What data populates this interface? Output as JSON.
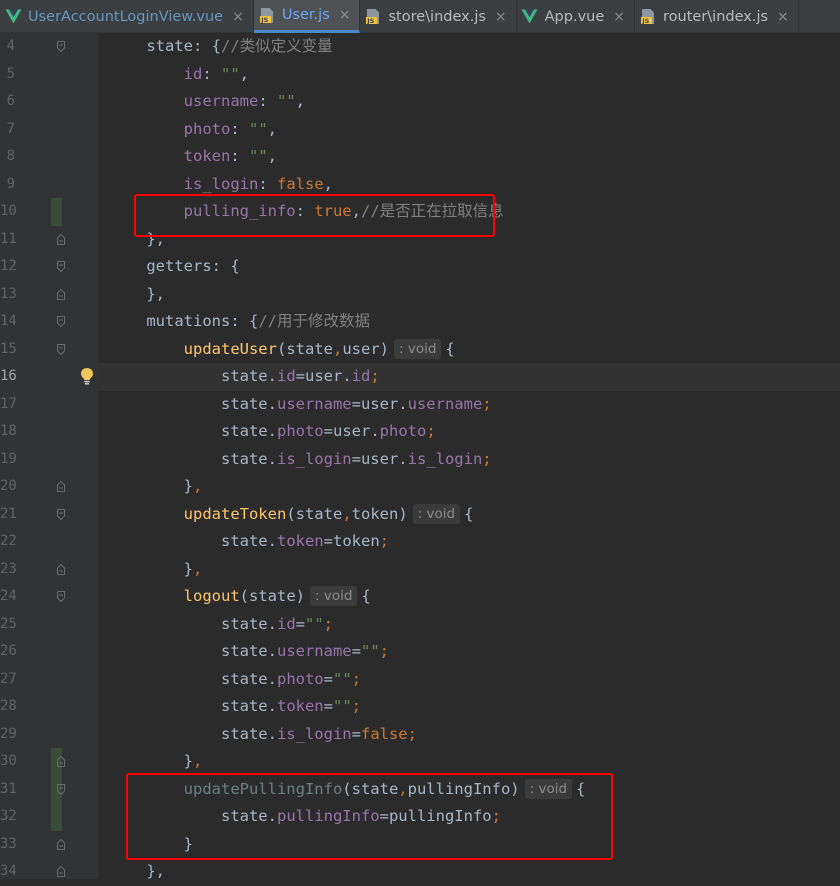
{
  "tabs": [
    {
      "label": "UserAccountLoginView.vue",
      "icon": "vue-icon",
      "active": false
    },
    {
      "label": "User.js",
      "icon": "js-file-icon",
      "active": true
    },
    {
      "label": "store\\index.js",
      "icon": "js-file-icon",
      "active": false
    },
    {
      "label": "App.vue",
      "icon": "vue-icon",
      "active": false
    },
    {
      "label": "router\\index.js",
      "icon": "js-file-icon",
      "active": false
    }
  ],
  "close_glyph": "×",
  "current_line": "16",
  "lines": [
    {
      "n": "4",
      "t": [
        [
          "plain",
          "    state: {"
        ],
        [
          "cmt",
          "//类似定义变量"
        ]
      ]
    },
    {
      "n": "5",
      "t": [
        [
          "plain",
          "        "
        ],
        [
          "prop",
          "id"
        ],
        [
          "plain",
          ": "
        ],
        [
          "str",
          "\"\""
        ],
        [
          "plain",
          ","
        ]
      ]
    },
    {
      "n": "6",
      "t": [
        [
          "plain",
          "        "
        ],
        [
          "prop",
          "username"
        ],
        [
          "plain",
          ": "
        ],
        [
          "str",
          "\"\""
        ],
        [
          "plain",
          ","
        ]
      ]
    },
    {
      "n": "7",
      "t": [
        [
          "plain",
          "        "
        ],
        [
          "prop",
          "photo"
        ],
        [
          "plain",
          ": "
        ],
        [
          "str",
          "\"\""
        ],
        [
          "plain",
          ","
        ]
      ]
    },
    {
      "n": "8",
      "t": [
        [
          "plain",
          "        "
        ],
        [
          "prop",
          "token"
        ],
        [
          "plain",
          ": "
        ],
        [
          "str",
          "\"\""
        ],
        [
          "plain",
          ","
        ]
      ]
    },
    {
      "n": "9",
      "t": [
        [
          "plain",
          "        "
        ],
        [
          "prop",
          "is_login"
        ],
        [
          "plain",
          ": "
        ],
        [
          "kw",
          "false"
        ],
        [
          "plain",
          ","
        ]
      ]
    },
    {
      "n": "10",
      "t": [
        [
          "plain",
          "        "
        ],
        [
          "prop",
          "pulling_info"
        ],
        [
          "plain",
          ": "
        ],
        [
          "kw",
          "true"
        ],
        [
          "plain",
          ","
        ],
        [
          "cmt",
          "//是否正在拉取信息"
        ]
      ]
    },
    {
      "n": "11",
      "t": [
        [
          "plain",
          "    },"
        ]
      ]
    },
    {
      "n": "12",
      "t": [
        [
          "plain",
          "    getters: {"
        ]
      ]
    },
    {
      "n": "13",
      "t": [
        [
          "plain",
          "    },"
        ]
      ]
    },
    {
      "n": "14",
      "t": [
        [
          "plain",
          "    mutations: {"
        ],
        [
          "cmt",
          "//用于修改数据"
        ]
      ]
    },
    {
      "n": "15",
      "t": [
        [
          "plain",
          "        "
        ],
        [
          "fn",
          "updateUser"
        ],
        [
          "plain",
          "(state"
        ],
        [
          "kw",
          ","
        ],
        [
          "plain",
          "user)"
        ],
        [
          "hint",
          ": void"
        ],
        [
          "plain",
          "{"
        ]
      ]
    },
    {
      "n": "16",
      "t": [
        [
          "plain",
          "            state."
        ],
        [
          "prop",
          "id"
        ],
        [
          "plain",
          "=user."
        ],
        [
          "prop",
          "id"
        ],
        [
          "kw",
          ";"
        ]
      ]
    },
    {
      "n": "17",
      "t": [
        [
          "plain",
          "            state."
        ],
        [
          "prop",
          "username"
        ],
        [
          "plain",
          "=user."
        ],
        [
          "prop",
          "username"
        ],
        [
          "kw",
          ";"
        ]
      ]
    },
    {
      "n": "18",
      "t": [
        [
          "plain",
          "            state."
        ],
        [
          "prop",
          "photo"
        ],
        [
          "plain",
          "=user."
        ],
        [
          "prop",
          "photo"
        ],
        [
          "kw",
          ";"
        ]
      ]
    },
    {
      "n": "19",
      "t": [
        [
          "plain",
          "            state."
        ],
        [
          "prop",
          "is_login"
        ],
        [
          "plain",
          "=user."
        ],
        [
          "prop",
          "is_login"
        ],
        [
          "kw",
          ";"
        ]
      ]
    },
    {
      "n": "20",
      "t": [
        [
          "plain",
          "        }"
        ],
        [
          "kw",
          ","
        ]
      ]
    },
    {
      "n": "21",
      "t": [
        [
          "plain",
          "        "
        ],
        [
          "fn",
          "updateToken"
        ],
        [
          "plain",
          "(state"
        ],
        [
          "kw",
          ","
        ],
        [
          "plain",
          "token)"
        ],
        [
          "hint",
          ": void"
        ],
        [
          "plain",
          "{"
        ]
      ]
    },
    {
      "n": "22",
      "t": [
        [
          "plain",
          "            state."
        ],
        [
          "prop",
          "token"
        ],
        [
          "plain",
          "=token"
        ],
        [
          "kw",
          ";"
        ]
      ]
    },
    {
      "n": "23",
      "t": [
        [
          "plain",
          "        }"
        ],
        [
          "kw",
          ","
        ]
      ]
    },
    {
      "n": "24",
      "t": [
        [
          "plain",
          "        "
        ],
        [
          "fn",
          "logout"
        ],
        [
          "plain",
          "(state)"
        ],
        [
          "hint",
          ": void"
        ],
        [
          "plain",
          "{"
        ]
      ]
    },
    {
      "n": "25",
      "t": [
        [
          "plain",
          "            state."
        ],
        [
          "prop",
          "id"
        ],
        [
          "plain",
          "="
        ],
        [
          "str",
          "\"\""
        ],
        [
          "kw",
          ";"
        ]
      ]
    },
    {
      "n": "26",
      "t": [
        [
          "plain",
          "            state."
        ],
        [
          "prop",
          "username"
        ],
        [
          "plain",
          "="
        ],
        [
          "str",
          "\"\""
        ],
        [
          "kw",
          ";"
        ]
      ]
    },
    {
      "n": "27",
      "t": [
        [
          "plain",
          "            state."
        ],
        [
          "prop",
          "photo"
        ],
        [
          "plain",
          "="
        ],
        [
          "str",
          "\"\""
        ],
        [
          "kw",
          ";"
        ]
      ]
    },
    {
      "n": "28",
      "t": [
        [
          "plain",
          "            state."
        ],
        [
          "prop",
          "token"
        ],
        [
          "plain",
          "="
        ],
        [
          "str",
          "\"\""
        ],
        [
          "kw",
          ";"
        ]
      ]
    },
    {
      "n": "29",
      "t": [
        [
          "plain",
          "            state."
        ],
        [
          "prop",
          "is_login"
        ],
        [
          "plain",
          "="
        ],
        [
          "kw",
          "false"
        ],
        [
          "kw",
          ";"
        ]
      ]
    },
    {
      "n": "30",
      "t": [
        [
          "plain",
          "        }"
        ],
        [
          "kw",
          ","
        ]
      ]
    },
    {
      "n": "31",
      "t": [
        [
          "plain",
          "        "
        ],
        [
          "unused",
          "updatePullingInfo"
        ],
        [
          "plain",
          "(state"
        ],
        [
          "kw",
          ","
        ],
        [
          "plain",
          "pullingInfo)"
        ],
        [
          "hint",
          ": void"
        ],
        [
          "plain",
          "{"
        ]
      ]
    },
    {
      "n": "32",
      "t": [
        [
          "plain",
          "            state."
        ],
        [
          "prop",
          "pullingInfo"
        ],
        [
          "plain",
          "=pullingInfo"
        ],
        [
          "kw",
          ";"
        ]
      ]
    },
    {
      "n": "33",
      "t": [
        [
          "plain",
          "        }"
        ]
      ]
    },
    {
      "n": "34",
      "t": [
        [
          "plain",
          "    },"
        ]
      ]
    }
  ]
}
